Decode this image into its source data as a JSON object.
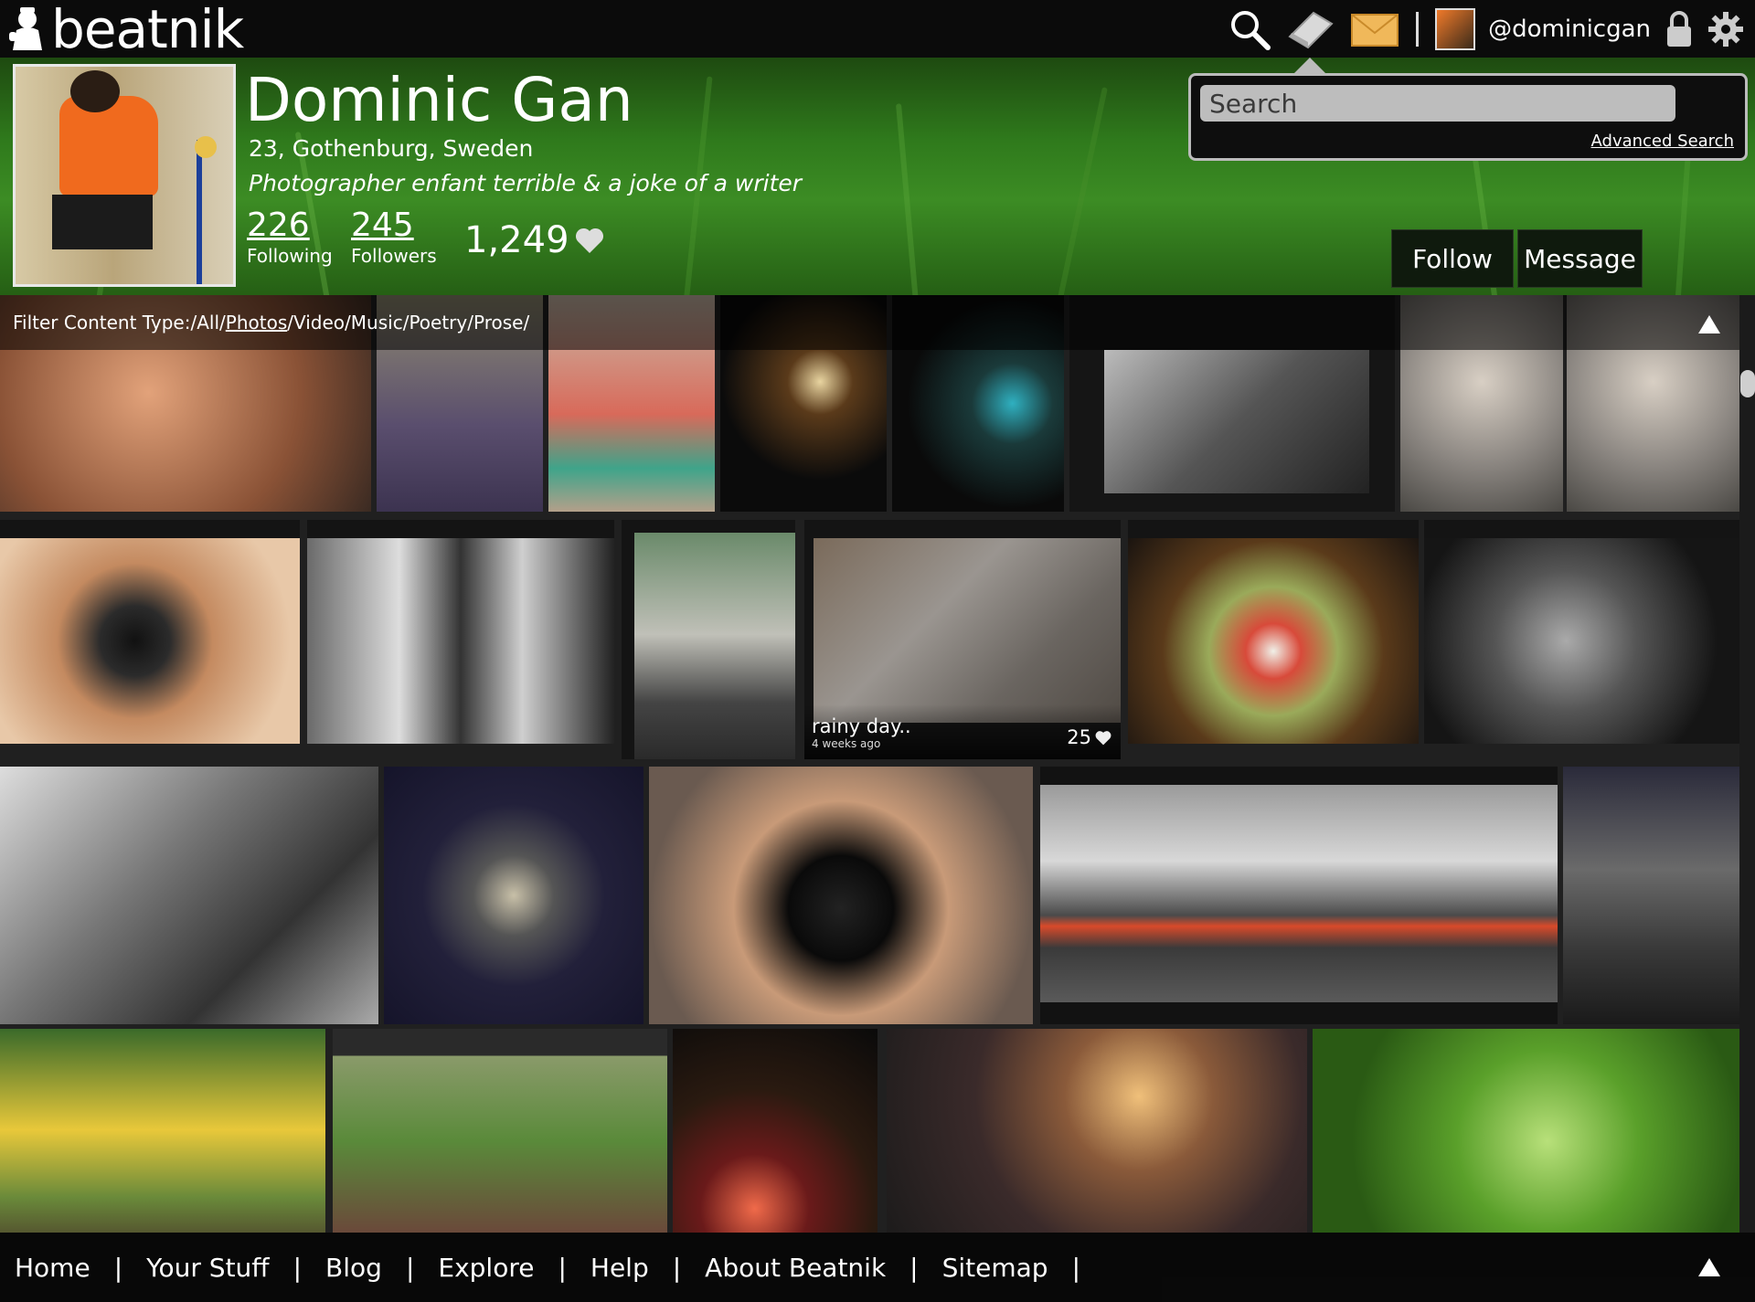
{
  "app": {
    "name": "beatnik"
  },
  "topbar": {
    "icons": [
      "search-icon",
      "notebook-icon",
      "mail-icon",
      "lock-icon",
      "gear-icon"
    ],
    "username": "@dominicgan"
  },
  "profile": {
    "name": "Dominic Gan",
    "location": "23, Gothenburg, Sweden",
    "bio": "Photographer enfant terrible & a joke of a writer",
    "following_count": "226",
    "following_label": "Following",
    "followers_count": "245",
    "followers_label": "Followers",
    "likes": "1,249"
  },
  "search": {
    "placeholder": "Search",
    "advanced_label": "Advanced Search"
  },
  "actions": {
    "follow_label": "Follow",
    "message_label": "Message"
  },
  "filter": {
    "label": "Filter Content Type:",
    "options": [
      "All",
      "Photos",
      "Video",
      "Music",
      "Poetry/Prose"
    ],
    "active": "Photos"
  },
  "feature_tile": {
    "title": "rainy day..",
    "age": "4 weeks ago",
    "likes": "25"
  },
  "bottom_nav": [
    "Home",
    "Your Stuff",
    "Blog",
    "Explore",
    "Help",
    "About Beatnik",
    "Sitemap"
  ],
  "colors": {
    "header_green": "#2f7a1c",
    "bar_black": "#0b0b0b"
  }
}
